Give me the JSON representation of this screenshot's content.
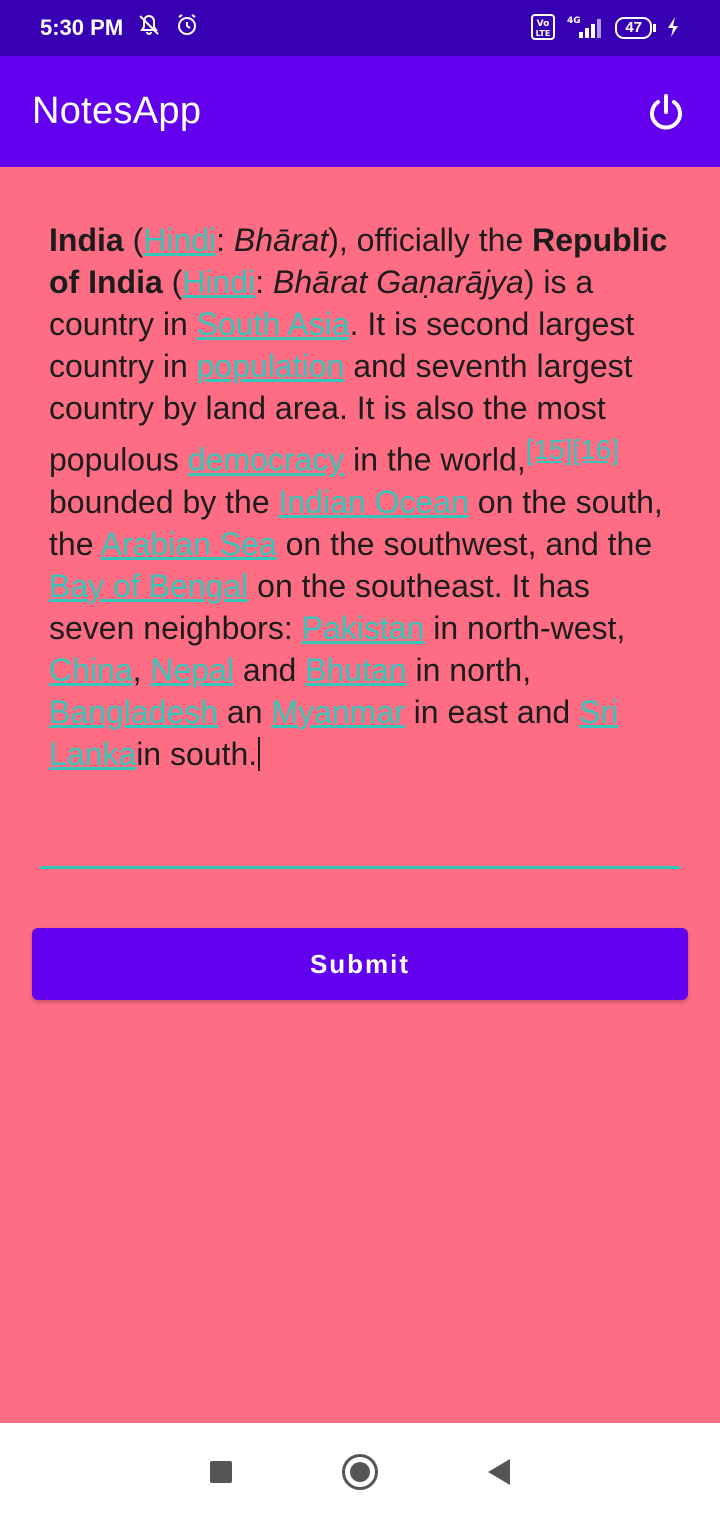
{
  "status_bar": {
    "time": "5:30 PM",
    "network_label": "4G",
    "volte_label": "Vo LTE",
    "battery_level": "47",
    "icons": [
      "mute-bell-icon",
      "alarm-icon",
      "volte-icon",
      "signal-icon",
      "battery-icon",
      "charging-icon"
    ]
  },
  "app_bar": {
    "title": "NotesApp",
    "action_icon": "power-icon"
  },
  "note": {
    "t_india": "India",
    "t_paren_open": " (",
    "l_hindi_1": "Hindi",
    "t_colon_1": ": ",
    "t_bharat": "Bhārat",
    "t_officially": "), officially the ",
    "t_republic": "Republic of India",
    "t_paren_open_2": " (",
    "l_hindi_2": "Hindi",
    "t_colon_2": ": ",
    "t_ganarajya": "Bhārat Gaṇarājya",
    "t_country_in": ") is a country in ",
    "l_south_asia": "South Asia",
    "t_second": ". It is second largest country in ",
    "l_population": "population",
    "t_seventh": " and seventh largest country by land area. It is also the most populous ",
    "l_democracy": "democracy",
    "t_in_the_world": " in the world,",
    "l_ref": "[15][16]",
    "t_bounded": " bounded by the ",
    "l_indian_ocean": "Indian Ocean",
    "t_south": " on the south, the ",
    "l_arabian_sea": "Arabian Sea",
    "t_southwest": " on the southwest, and the ",
    "l_bay_of_bengal": "Bay of Bengal",
    "t_southeast": " on the southeast. It has seven neighbors: ",
    "l_pakistan": "Pakistan",
    "t_nw": " in north-west, ",
    "l_china": "China",
    "t_comma": ", ",
    "l_nepal": "Nepal",
    "t_and": " and ",
    "l_bhutan": "Bhutan",
    "t_in_north": " in north, ",
    "l_bangladesh": "Bangladesh",
    "t_an": " an ",
    "l_myanmar": "Myanmar",
    "t_in_east": " in east and ",
    "l_sri_lanka": "Sri Lanka",
    "t_in_south": "in south."
  },
  "submit_label": "Submit",
  "nav": {
    "recents_icon": "square-icon",
    "home_icon": "circle-home-icon",
    "back_icon": "triangle-back-icon"
  },
  "colors": {
    "status_bar": "#3700b3",
    "app_bar": "#6200ee",
    "background": "#ff6d84",
    "link": "#33c6b8",
    "button": "#6200ee"
  }
}
